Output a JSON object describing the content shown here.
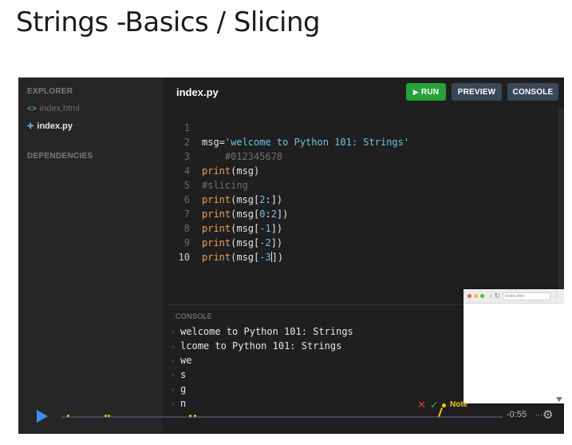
{
  "page": {
    "title": "Strings -Basics / Slicing"
  },
  "sidebar": {
    "explorer_label": "EXPLORER",
    "files": [
      {
        "name": "index.html",
        "icon": "code-icon",
        "active": false
      },
      {
        "name": "index.py",
        "icon": "python-icon",
        "active": true
      }
    ],
    "dependencies_label": "DEPENDENCIES"
  },
  "editor": {
    "tab": "index.py",
    "buttons": {
      "run": "RUN",
      "preview": "PREVIEW",
      "console": "CONSOLE"
    },
    "line_numbers": [
      "1",
      "2",
      "3",
      "4",
      "5",
      "6",
      "7",
      "8",
      "9",
      "10"
    ],
    "lines": [
      [],
      [
        {
          "t": "msg=",
          "c": "plain"
        },
        {
          "t": "'welcome to Python 101: Strings'",
          "c": "str"
        }
      ],
      [
        {
          "t": "    #012345678",
          "c": "com"
        }
      ],
      [
        {
          "t": "print",
          "c": "fn"
        },
        {
          "t": "(msg)",
          "c": "plain"
        }
      ],
      [
        {
          "t": "#slicing",
          "c": "com"
        }
      ],
      [
        {
          "t": "print",
          "c": "fn"
        },
        {
          "t": "(msg[",
          "c": "plain"
        },
        {
          "t": "2",
          "c": "num"
        },
        {
          "t": ":])",
          "c": "plain"
        }
      ],
      [
        {
          "t": "print",
          "c": "fn"
        },
        {
          "t": "(msg[",
          "c": "plain"
        },
        {
          "t": "0",
          "c": "num"
        },
        {
          "t": ":",
          "c": "plain"
        },
        {
          "t": "2",
          "c": "num"
        },
        {
          "t": "])",
          "c": "plain"
        }
      ],
      [
        {
          "t": "print",
          "c": "fn"
        },
        {
          "t": "(msg[",
          "c": "plain"
        },
        {
          "t": "-1",
          "c": "num"
        },
        {
          "t": "])",
          "c": "plain"
        }
      ],
      [
        {
          "t": "print",
          "c": "fn"
        },
        {
          "t": "(msg[",
          "c": "plain"
        },
        {
          "t": "-2",
          "c": "num"
        },
        {
          "t": "])",
          "c": "plain"
        }
      ],
      [
        {
          "t": "print",
          "c": "fn"
        },
        {
          "t": "(msg[",
          "c": "plain"
        },
        {
          "t": "-3",
          "c": "num"
        },
        {
          "t": "|",
          "c": "cursor"
        },
        {
          "t": "])",
          "c": "plain"
        }
      ]
    ]
  },
  "console": {
    "label": "CONSOLE",
    "output": [
      "welcome to Python 101: Strings",
      "lcome to Python 101: Strings",
      "we",
      "s",
      "g",
      "n"
    ]
  },
  "preview": {
    "url": "/index.html"
  },
  "playback": {
    "time": "-0:55",
    "note_label": "Note",
    "colors": {
      "accent": "#3d8ef0",
      "marker": "#f5c518",
      "run": "#27a13a",
      "button": "#384858"
    }
  }
}
